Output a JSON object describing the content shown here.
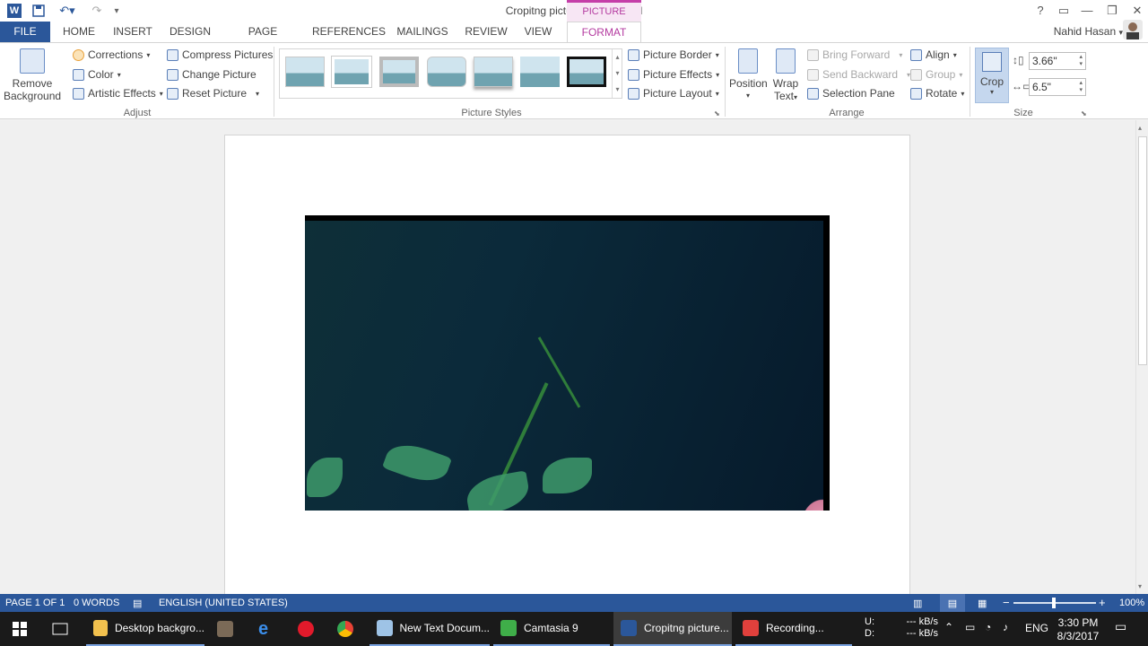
{
  "titlebar": {
    "title": "Cropitng picture.docx - Word",
    "picture_tools": "PICTURE TOOLS",
    "word_logo": "W",
    "help": "?",
    "minimize": "—",
    "restore": "❐",
    "close": "✕"
  },
  "tabs": {
    "file": "FILE",
    "home": "HOME",
    "insert": "INSERT",
    "design": "DESIGN",
    "page_layout": "PAGE LAYOUT",
    "references": "REFERENCES",
    "mailings": "MAILINGS",
    "review": "REVIEW",
    "view": "VIEW",
    "format": "FORMAT"
  },
  "user": {
    "name": "Nahid Hasan"
  },
  "ribbon": {
    "adjust": {
      "remove_background_1": "Remove",
      "remove_background_2": "Background",
      "corrections": "Corrections",
      "color": "Color",
      "artistic_effects": "Artistic Effects",
      "compress_pictures": "Compress Pictures",
      "change_picture": "Change Picture",
      "reset_picture": "Reset Picture",
      "label": "Adjust"
    },
    "picture_styles": {
      "label": "Picture Styles",
      "picture_border": "Picture Border",
      "picture_effects": "Picture Effects",
      "picture_layout": "Picture Layout"
    },
    "arrange": {
      "position": "Position",
      "wrap_text_1": "Wrap",
      "wrap_text_2": "Text",
      "bring_forward": "Bring Forward",
      "send_backward": "Send Backward",
      "selection_pane": "Selection Pane",
      "align": "Align",
      "group": "Group",
      "rotate": "Rotate",
      "label": "Arrange"
    },
    "size": {
      "crop": "Crop",
      "height": "3.66\"",
      "width": "6.5\"",
      "label": "Size"
    }
  },
  "statusbar": {
    "page": "PAGE 1 OF 1",
    "words": "0 WORDS",
    "language": "ENGLISH (UNITED STATES)",
    "zoom": "100%",
    "zoom_minus": "−",
    "zoom_plus": "+"
  },
  "taskbar": {
    "items": [
      {
        "label": "Desktop backgro..."
      },
      {
        "label": "New Text Docum..."
      },
      {
        "label": "Camtasia 9"
      },
      {
        "label": "Cropitng picture..."
      },
      {
        "label": "Recording..."
      }
    ],
    "net_u": "U:",
    "net_d": "D:",
    "net_speed_u": "--- kB/s",
    "net_speed_d": "--- kB/s",
    "lang": "ENG",
    "time": "3:30 PM",
    "date": "8/3/2017"
  }
}
